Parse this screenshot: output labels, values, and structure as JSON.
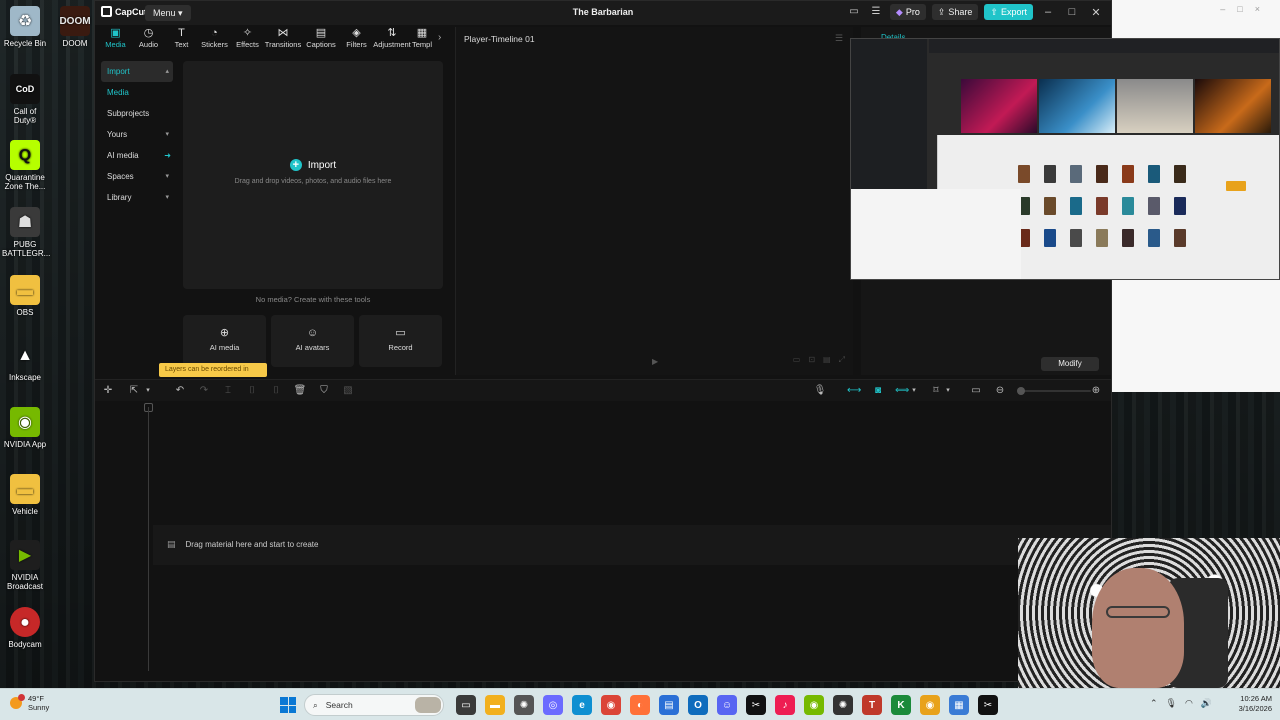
{
  "desktop": {
    "icons": [
      {
        "label": "Recycle Bin",
        "icon": "recycle-bin-icon",
        "color": "#9fb8c8"
      },
      {
        "label": "Call of Duty®",
        "icon": "call-of-duty-icon",
        "color": "#111111"
      },
      {
        "label": "Quarantine Zone The...",
        "icon": "quarantine-zone-icon",
        "color": "#b6ff00"
      },
      {
        "label": "PUBG BATTLEGR...",
        "icon": "pubg-icon",
        "color": "#3a3a3a"
      },
      {
        "label": "OBS",
        "icon": "folder-icon",
        "color": "#f0c040"
      },
      {
        "label": "Inkscape",
        "icon": "inkscape-icon",
        "color": "#222222"
      },
      {
        "label": "NVIDIA App",
        "icon": "nvidia-icon",
        "color": "#76b900"
      },
      {
        "label": "Vehicle",
        "icon": "folder-icon",
        "color": "#f0c040"
      },
      {
        "label": "NVIDIA Broadcast",
        "icon": "nvidia-broadcast-icon",
        "color": "#76b900"
      },
      {
        "label": "Bodycam",
        "icon": "bodycam-icon",
        "color": "#c62828"
      }
    ],
    "doom": {
      "label": "DOOM",
      "icon": "doom-icon"
    }
  },
  "app": {
    "name": "CapCut",
    "menu_label": "Menu",
    "project_title": "The Barbarian",
    "pro_label": "Pro",
    "share_label": "Share",
    "export_label": "Export",
    "tabs": [
      {
        "label": "Media",
        "icon": "media-icon",
        "active": true
      },
      {
        "label": "Audio",
        "icon": "audio-icon"
      },
      {
        "label": "Text",
        "icon": "text-icon"
      },
      {
        "label": "Stickers",
        "icon": "stickers-icon"
      },
      {
        "label": "Effects",
        "icon": "effects-icon"
      },
      {
        "label": "Transitions",
        "icon": "transitions-icon"
      },
      {
        "label": "Captions",
        "icon": "captions-icon"
      },
      {
        "label": "Filters",
        "icon": "filters-icon"
      },
      {
        "label": "Adjustment",
        "icon": "adjustment-icon"
      },
      {
        "label": "Templ",
        "icon": "templates-icon"
      }
    ],
    "nav": [
      {
        "label": "Import"
      },
      {
        "label": "Media"
      },
      {
        "label": "Subprojects"
      },
      {
        "label": "Yours"
      },
      {
        "label": "AI media"
      },
      {
        "label": "Spaces"
      },
      {
        "label": "Library"
      }
    ],
    "media": {
      "import_label": "Import",
      "import_hint": "Drag and drop videos, photos, and audio files here",
      "no_media": "No media? Create with these tools",
      "tools": [
        {
          "label": "AI media",
          "icon": "ai-media-icon"
        },
        {
          "label": "AI avatars",
          "icon": "ai-avatars-icon"
        },
        {
          "label": "Record",
          "icon": "record-icon"
        }
      ]
    },
    "player": {
      "title": "Player-Timeline 01"
    },
    "details": {
      "title": "Details",
      "tip": "Layers can be reordered in",
      "modify_label": "Modify"
    },
    "timeline": {
      "hint": "Drag material here and start to create"
    },
    "colors": {
      "accent": "#20c4c9",
      "background": "#121212",
      "tip": "#f7c948"
    }
  },
  "taskbar": {
    "weather_temp": "49°F",
    "weather_desc": "Sunny",
    "search_placeholder": "Search",
    "time": "10:26 AM",
    "date": "3/16/2026",
    "apps": [
      {
        "icon": "file-explorer-icon",
        "color": "#f2b01e"
      },
      {
        "icon": "chatgpt-icon",
        "color": "#555555"
      },
      {
        "icon": "copilot-icon",
        "color": "#6b6bff"
      },
      {
        "icon": "edge-icon",
        "color": "#0e8fd1"
      },
      {
        "icon": "chrome-icon",
        "color": "#db4437"
      },
      {
        "icon": "firefox-icon",
        "color": "#ff7139"
      },
      {
        "icon": "store-icon",
        "color": "#2a6fd6"
      },
      {
        "icon": "outlook-icon",
        "color": "#0f6cbd"
      },
      {
        "icon": "discord-icon",
        "color": "#5865f2"
      },
      {
        "icon": "capcut-icon",
        "color": "#111111"
      },
      {
        "icon": "tiktok-icon",
        "color": "#ee1d52"
      },
      {
        "icon": "nvidia-icon",
        "color": "#76b900"
      },
      {
        "icon": "openai-icon",
        "color": "#333333"
      },
      {
        "icon": "typora-icon",
        "color": "#c0392b"
      },
      {
        "icon": "krita-icon",
        "color": "#1b8a3a"
      },
      {
        "icon": "chrome-canary-icon",
        "color": "#e8a21b"
      },
      {
        "icon": "calculator-icon",
        "color": "#3a7bd5"
      },
      {
        "icon": "capcut-active-icon",
        "color": "#111111"
      }
    ]
  }
}
